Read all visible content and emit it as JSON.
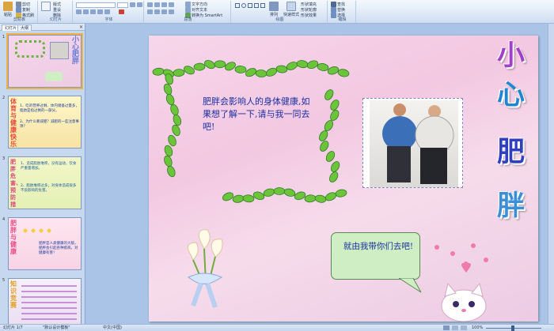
{
  "ribbon": {
    "clipboard": {
      "label": "剪贴板",
      "paste": "粘贴",
      "copy": "复制",
      "format_painter": "格式刷",
      "cut": "剪切"
    },
    "slides": {
      "label": "幻灯片",
      "new_slide": "新建\n幻灯片",
      "layout": "版式",
      "reset": "重设",
      "delete": "删除"
    },
    "font": {
      "label": "字体"
    },
    "paragraph": {
      "label": "段落",
      "text_direction": "文字方向",
      "align_text": "对齐文本",
      "smartart": "转换为 SmartArt"
    },
    "drawing": {
      "label": "绘图",
      "arrange": "排列",
      "quick_styles": "快速样式",
      "shape_fill": "形状填充",
      "shape_outline": "形状轮廓",
      "shape_effects": "形状效果"
    },
    "editing": {
      "label": "编辑",
      "find": "查找",
      "replace": "替换",
      "select": "选择"
    }
  },
  "left_pane": {
    "tabs": [
      "幻灯片",
      "大纲"
    ],
    "close": "×",
    "slides": [
      {
        "num": "1",
        "title": "小心肥胖"
      },
      {
        "num": "2",
        "title": "体育与健康快乐",
        "lines": [
          "1、吃的营养过剩、体内储备过量多，脂肪是指过剩的一部分。",
          "2、为什么要减肥？减肥的一些注意事项？"
        ]
      },
      {
        "num": "3",
        "title": "肥胖危害、预防措施",
        "lines": [
          "1、造成脂肪堆积，没有运动，饮食严重量增加。",
          "2、脂肪堆积过多，对身体造成很多不良影响的危害。"
        ]
      },
      {
        "num": "4",
        "title": "肥胖与健康",
        "lines": [
          "肥胖是人类健康的大敌，肥胖会引起各种疾病，对健康有害！"
        ]
      },
      {
        "num": "5",
        "title": "知识竞赛"
      }
    ]
  },
  "slide": {
    "main_text": "肥胖会影响人的身体健康,如果想了解一下,请与我一同去吧!",
    "bubble_text": "就由我带你们去吧!",
    "title_chars": [
      "小",
      "心",
      "肥",
      "胖"
    ],
    "title_colors": [
      "#a23fc9",
      "#1f86cf",
      "#2f3fbf",
      "#3a8fd6"
    ]
  },
  "status": {
    "slide_info": "幻灯片 1/7",
    "theme": "\"默认设计模板\"",
    "language": "中文(中国)",
    "zoom": "100%"
  },
  "colors": {
    "ribbon_bg": "#dbe7f6",
    "slide_bg": "#f3c8e2",
    "bubble": "#cfeec3",
    "text_blue": "#1a2fa0"
  }
}
